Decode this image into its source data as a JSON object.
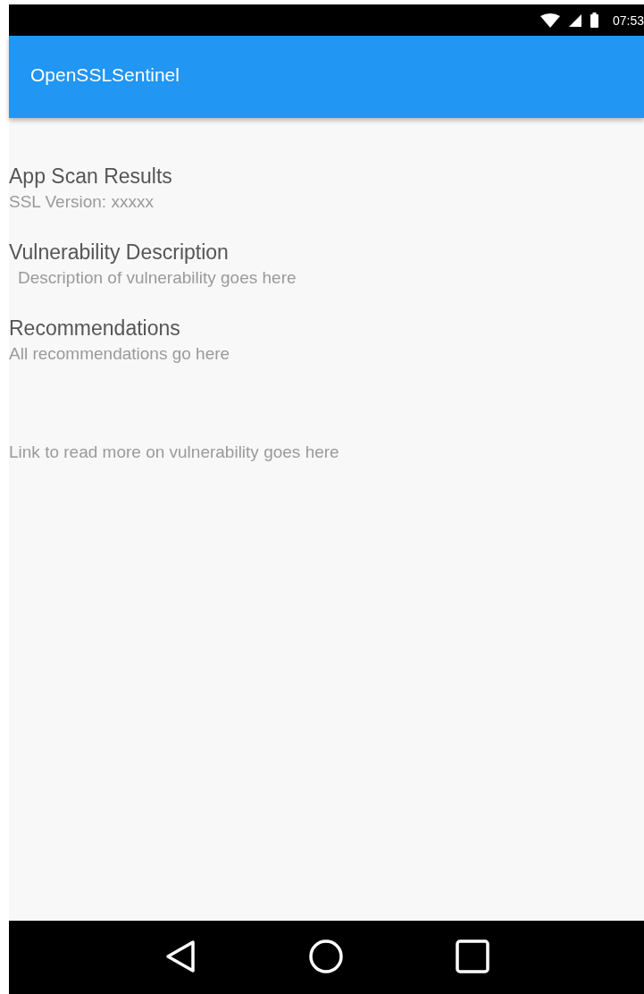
{
  "status_bar": {
    "time": "07:53"
  },
  "app_bar": {
    "title": "OpenSSLSentinel"
  },
  "sections": [
    {
      "heading": "App Scan Results",
      "body": "SSL Version: xxxxx"
    },
    {
      "heading": "Vulnerability Description",
      "body": "Description of vulnerability goes here"
    },
    {
      "heading": "Recommendations",
      "body": "All recommendations go here"
    }
  ],
  "link": "Link to read more on vulnerability goes here"
}
